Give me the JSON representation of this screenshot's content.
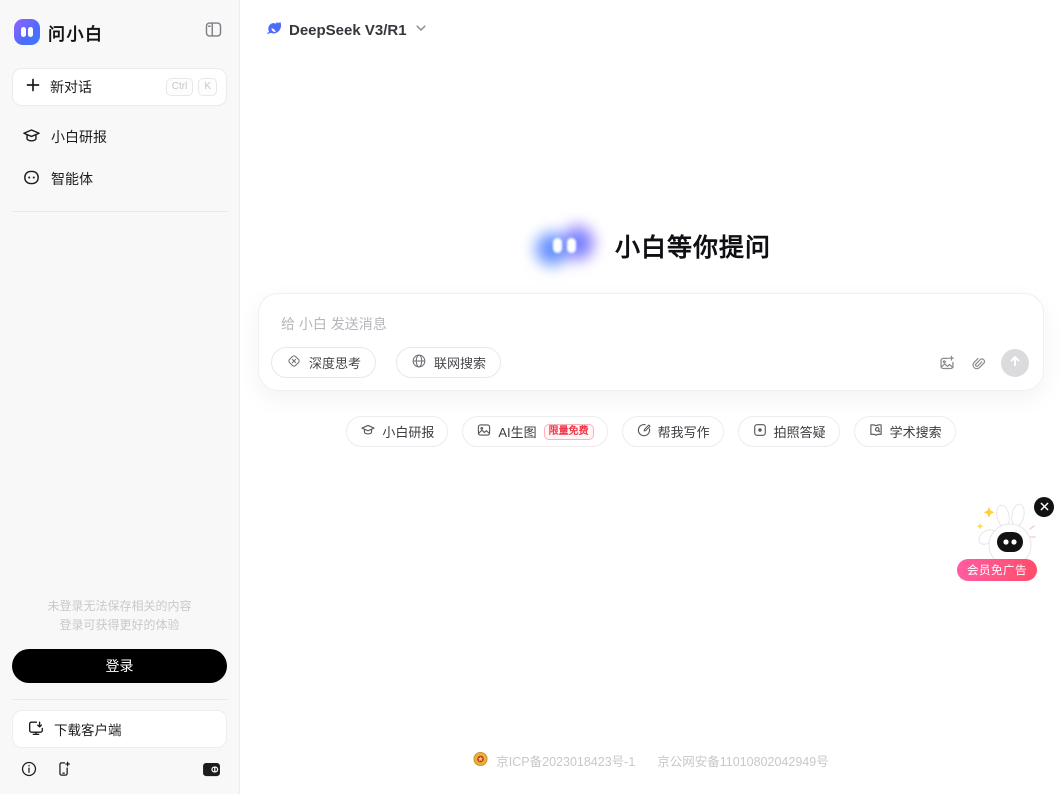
{
  "colors": {
    "accent": "#4D6BFE",
    "brand_gradient_start": "#8A63FF",
    "brand_gradient_end": "#3D7BFF",
    "badge_red": "#F5394D",
    "promo_pink": "#FF4D7D",
    "login_black": "#000000",
    "sidebar_bg": "#F8F8F9"
  },
  "sidebar": {
    "brand": "问小白",
    "new_chat_label": "新对话",
    "shortcut_ctrl": "Ctrl",
    "shortcut_key": "K",
    "nav": [
      {
        "label": "小白研报"
      },
      {
        "label": "智能体"
      }
    ],
    "login_hint_line1": "未登录无法保存相关的内容",
    "login_hint_line2": "登录可获得更好的体验",
    "login_button": "登录",
    "download_button": "下载客户端"
  },
  "header": {
    "model_selector": "DeepSeek V3/R1"
  },
  "main": {
    "hero_title": "小白等你提问",
    "input_placeholder": "给 小白 发送消息",
    "tool_deep_think": "深度思考",
    "tool_web_search": "联网搜索",
    "suggestions": [
      {
        "label": "小白研报"
      },
      {
        "label": "AI生图",
        "badge": "限量免费"
      },
      {
        "label": "帮我写作"
      },
      {
        "label": "拍照答疑"
      },
      {
        "label": "学术搜索"
      }
    ],
    "promo_badge": "会员免广告"
  },
  "footer": {
    "icp": "京ICP备2023018423号-1",
    "police": "京公网安备11010802042949号"
  }
}
